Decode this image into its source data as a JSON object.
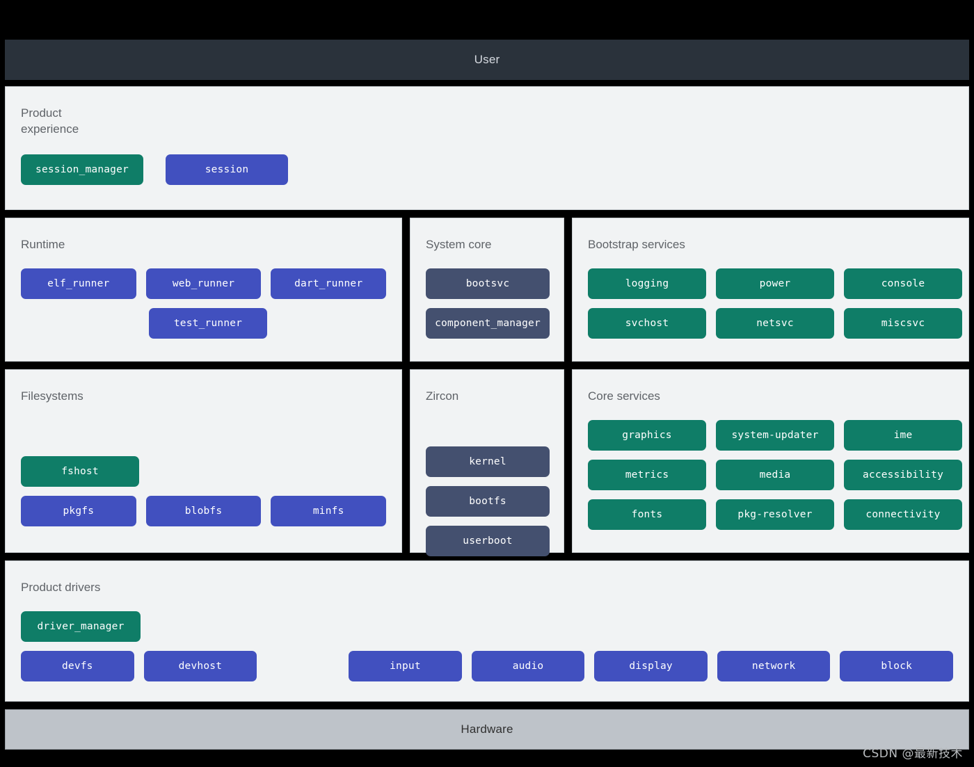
{
  "colors": {
    "green": "#0f7d67",
    "blue": "#4150bf",
    "slate": "#44506f",
    "panel_bg": "#f1f3f4",
    "user_band_bg": "#2a323b",
    "hardware_band_bg": "#bec3c9",
    "background": "#000000",
    "title_text": "#5f6368"
  },
  "bands": {
    "top_label": "User",
    "bottom_label": "Hardware"
  },
  "panels": {
    "product_experience": {
      "title": "Product\nexperience",
      "nodes": [
        {
          "label": "session_manager",
          "color": "green"
        },
        {
          "label": "session",
          "color": "blue"
        }
      ]
    },
    "runtime": {
      "title": "Runtime",
      "row1": [
        {
          "label": "elf_runner",
          "color": "blue"
        },
        {
          "label": "web_runner",
          "color": "blue"
        },
        {
          "label": "dart_runner",
          "color": "blue"
        }
      ],
      "row2": [
        {
          "label": "test_runner",
          "color": "blue"
        }
      ]
    },
    "system_core": {
      "title": "System core",
      "nodes": [
        {
          "label": "bootsvc",
          "color": "slate"
        },
        {
          "label": "component_manager",
          "color": "slate"
        }
      ]
    },
    "bootstrap_services": {
      "title": "Bootstrap services",
      "nodes": [
        {
          "label": "logging",
          "color": "green"
        },
        {
          "label": "power",
          "color": "green"
        },
        {
          "label": "console",
          "color": "green"
        },
        {
          "label": "svchost",
          "color": "green"
        },
        {
          "label": "netsvc",
          "color": "green"
        },
        {
          "label": "miscsvc",
          "color": "green"
        }
      ]
    },
    "filesystems": {
      "title": "Filesystems",
      "row1": [
        {
          "label": "fshost",
          "color": "green"
        }
      ],
      "row2": [
        {
          "label": "pkgfs",
          "color": "blue"
        },
        {
          "label": "blobfs",
          "color": "blue"
        },
        {
          "label": "minfs",
          "color": "blue"
        }
      ]
    },
    "zircon": {
      "title": "Zircon",
      "nodes": [
        {
          "label": "kernel",
          "color": "slate"
        },
        {
          "label": "bootfs",
          "color": "slate"
        },
        {
          "label": "userboot",
          "color": "slate"
        }
      ]
    },
    "core_services": {
      "title": "Core services",
      "nodes": [
        {
          "label": "graphics",
          "color": "green"
        },
        {
          "label": "system-updater",
          "color": "green"
        },
        {
          "label": "ime",
          "color": "green"
        },
        {
          "label": "metrics",
          "color": "green"
        },
        {
          "label": "media",
          "color": "green"
        },
        {
          "label": "accessibility",
          "color": "green"
        },
        {
          "label": "fonts",
          "color": "green"
        },
        {
          "label": "pkg-resolver",
          "color": "green"
        },
        {
          "label": "connectivity",
          "color": "green"
        }
      ]
    },
    "product_drivers": {
      "title": "Product drivers",
      "row1": [
        {
          "label": "driver_manager",
          "color": "green"
        }
      ],
      "row2_left": [
        {
          "label": "devfs",
          "color": "blue"
        },
        {
          "label": "devhost",
          "color": "blue"
        }
      ],
      "row2_right": [
        {
          "label": "input",
          "color": "blue"
        },
        {
          "label": "audio",
          "color": "blue"
        },
        {
          "label": "display",
          "color": "blue"
        },
        {
          "label": "network",
          "color": "blue"
        },
        {
          "label": "block",
          "color": "blue"
        }
      ]
    }
  },
  "watermark": "CSDN @最新技术"
}
